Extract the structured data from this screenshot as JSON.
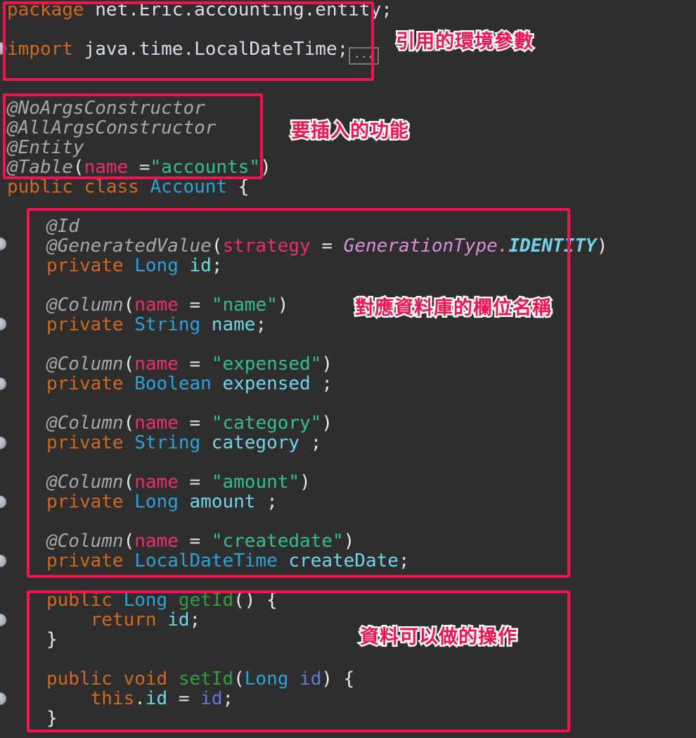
{
  "theme": {
    "background": "#2e2e2e",
    "highlight_border": "#f5124f",
    "callout_text": "#f5124f",
    "callout_outline": "#ffffff",
    "keyword": "#d2691e",
    "type": "#29a3d9",
    "field": "#6fd6e8",
    "annotation": "#a8a8a8",
    "attribute": "#e8306a",
    "string": "#2fc08b",
    "enum": "#d98fd9",
    "method": "#2f9e44",
    "param": "#5c7cd6"
  },
  "code": {
    "language": "java",
    "package_keyword": "package",
    "package_name": " net.Eric.accounting.entity;",
    "import_keyword": "import",
    "import_name": " java.time.LocalDateTime;",
    "fold_marker": "...",
    "class_annotations": [
      "@NoArgsConstructor",
      "@AllArgsConstructor",
      "@Entity"
    ],
    "table_annotation": {
      "name": "@Table",
      "open": "(",
      "attr": "name ",
      "eq": "=",
      "value": "\"accounts\"",
      "close": ")"
    },
    "class_declaration": {
      "modifier": "public class ",
      "name": "Account",
      "brace": " {"
    },
    "fields": [
      {
        "annotations": [
          "@Id"
        ],
        "generated_value": {
          "name": "@GeneratedValue",
          "open": "(",
          "attr": "strategy",
          "eq": " = ",
          "enum_type": "GenerationType",
          "dot": ".",
          "enum_value": "IDENTITY",
          "close": ")"
        },
        "modifier": "private ",
        "type": "Long",
        "field_name": " id",
        "terminator": ";"
      },
      {
        "column": {
          "name": "@Column",
          "open": "(",
          "attr": "name",
          "eq": " = ",
          "value": "\"name\"",
          "close": ")"
        },
        "modifier": "private ",
        "type": "String",
        "field_name": " name",
        "terminator": ";"
      },
      {
        "column": {
          "name": "@Column",
          "open": "(",
          "attr": "name",
          "eq": " = ",
          "value": "\"expensed\"",
          "close": ")"
        },
        "modifier": "private ",
        "type": "Boolean",
        "field_name": " expensed",
        "terminator": " ;"
      },
      {
        "column": {
          "name": "@Column",
          "open": "(",
          "attr": "name",
          "eq": " = ",
          "value": "\"category\"",
          "close": ")"
        },
        "modifier": "private ",
        "type": "String",
        "field_name": " category",
        "terminator": " ;"
      },
      {
        "column": {
          "name": "@Column",
          "open": "(",
          "attr": "name",
          "eq": " = ",
          "value": "\"amount\"",
          "close": ")"
        },
        "modifier": "private ",
        "type": "Long",
        "field_name": " amount",
        "terminator": " ;"
      },
      {
        "column": {
          "name": "@Column",
          "open": "(",
          "attr": "name",
          "eq": " = ",
          "value": "\"createdate\"",
          "close": ")"
        },
        "modifier": "private ",
        "type": "LocalDateTime",
        "field_name": " createDate",
        "terminator": ";"
      }
    ],
    "methods": {
      "getter": {
        "modifier": "public ",
        "type": "Long",
        "space": " ",
        "name": "getId",
        "signature": "() {",
        "body_keyword": "    return ",
        "body_value": "id",
        "body_terminator": ";",
        "close_brace": "}"
      },
      "setter": {
        "modifier": "public void ",
        "name": "setId",
        "open": "(",
        "param_type": "Long",
        "param_name": " id",
        "close": ") {",
        "body_this": "    this",
        "body_dot": ".",
        "body_field": "id",
        "body_eq": " = ",
        "body_param": "id",
        "body_terminator": ";",
        "close_brace": "}"
      }
    }
  },
  "callouts": [
    {
      "id": "imports",
      "text": "引用的環境參數"
    },
    {
      "id": "features",
      "text": "要插入的功能"
    },
    {
      "id": "db-columns",
      "text": "對應資料庫的欄位名稱"
    },
    {
      "id": "operations",
      "text": "資料可以做的操作"
    }
  ],
  "gutter": {
    "marker_name": "gutter-marker",
    "count": 8
  }
}
